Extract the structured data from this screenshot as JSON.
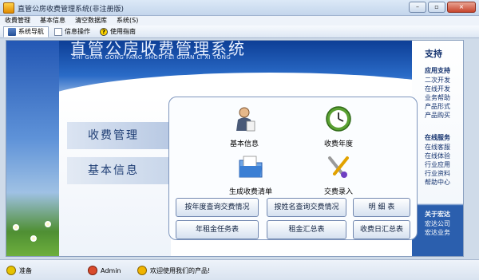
{
  "window": {
    "title": "直管公房收费管理系统(非注册版)",
    "controls": [
      "–",
      "▫",
      "×"
    ]
  },
  "menu": [
    "收費管理",
    "基本信息",
    "清空数据库",
    "系统(S)"
  ],
  "toolbar": {
    "items": [
      {
        "label": "系统导航",
        "icon": "nav-icon",
        "active": true
      },
      {
        "label": "信息操作",
        "icon": "document-icon",
        "active": false
      },
      {
        "label": "使用指南",
        "icon": "help-icon",
        "active": false
      }
    ]
  },
  "banner": {
    "title": "直管公房收费管理系统",
    "pinyin": "ZHI GUAN GONG FANG SHOU FEI GUAN LI XI TONG"
  },
  "nav": {
    "items": [
      "收费管理",
      "基本信息"
    ]
  },
  "tiles": [
    {
      "label": "基本信息",
      "icon": "person-icon"
    },
    {
      "label": "收费年度",
      "icon": "clock-icon"
    },
    {
      "label": "生成收费清单",
      "icon": "folder-icon"
    },
    {
      "label": "交费录入",
      "icon": "tools-icon"
    }
  ],
  "buttons": {
    "by_year": "按年度查询交费情况",
    "by_name": "按姓名查询交费情况",
    "detail": "明 细 表",
    "annual_task": "年租金任务表",
    "rent_summary": "租金汇总表",
    "daily_summary": "收费日汇总表"
  },
  "sidebar": {
    "top": "支持",
    "sections": [
      {
        "head": "应用支持",
        "items": [
          "二次开发",
          "在线开发",
          "业务帮助",
          "产品形式",
          "产品购买"
        ]
      },
      {
        "head": "在线服务",
        "items": [
          "在线客服",
          "在线体验",
          "行业应用",
          "行业资料",
          "帮助中心"
        ]
      },
      {
        "head": "关于宏达",
        "items": [
          "宏达公司",
          "宏达业务"
        ]
      }
    ]
  },
  "status": {
    "ready": "准备",
    "user": "Admin",
    "welcome": "欢迎使用我们的产品!"
  },
  "colors": {
    "accent": "#1d3c73",
    "banner_blue": "#0d3e96"
  }
}
